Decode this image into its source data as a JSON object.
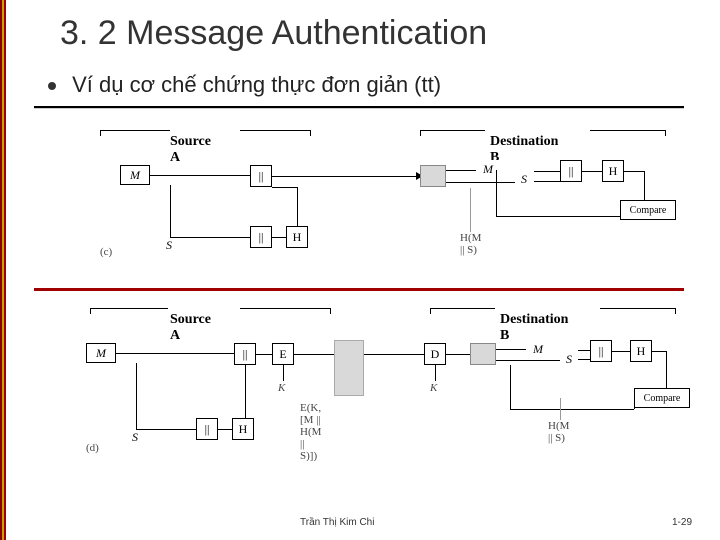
{
  "slide": {
    "title": "3. 2 Message Authentication",
    "bullet": "Ví dụ cơ chế chứng thực đơn giản (tt)"
  },
  "diagram_top": {
    "source_label": "Source A",
    "dest_label": "Destination B",
    "M": "M",
    "S": "S",
    "concat": "||",
    "H": "H",
    "M2": "M",
    "S2": "S",
    "H2": "H",
    "compare": "Compare",
    "hash": "H(M || S)",
    "marker": "(c)"
  },
  "diagram_bottom": {
    "source_label": "Source A",
    "dest_label": "Destination B",
    "M": "M",
    "S": "S",
    "K1": "K",
    "K2": "K",
    "E": "E",
    "D": "D",
    "concat": "||",
    "H": "H",
    "M2": "M",
    "S2": "S",
    "H2": "H",
    "compare": "Compare",
    "enc": "E(K, [M || H(M || S)])",
    "hash": "H(M || S)",
    "marker": "(d)"
  },
  "footer": {
    "author": "Trần Thị Kim Chi",
    "page": "1-29"
  }
}
